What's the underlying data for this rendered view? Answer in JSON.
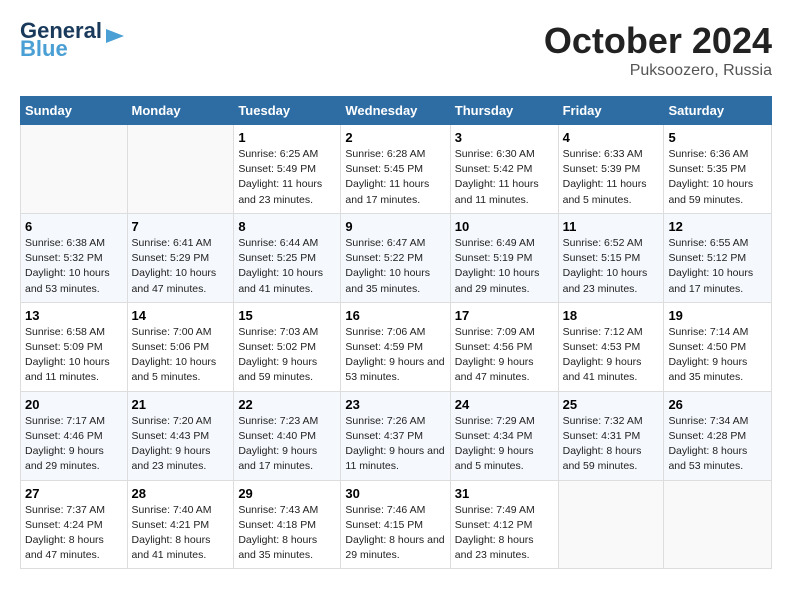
{
  "header": {
    "logo_line1": "General",
    "logo_line2": "Blue",
    "title": "October 2024",
    "subtitle": "Puksoozero, Russia"
  },
  "columns": [
    "Sunday",
    "Monday",
    "Tuesday",
    "Wednesday",
    "Thursday",
    "Friday",
    "Saturday"
  ],
  "weeks": [
    [
      {
        "day": "",
        "info": ""
      },
      {
        "day": "",
        "info": ""
      },
      {
        "day": "1",
        "info": "Sunrise: 6:25 AM\nSunset: 5:49 PM\nDaylight: 11 hours and 23 minutes."
      },
      {
        "day": "2",
        "info": "Sunrise: 6:28 AM\nSunset: 5:45 PM\nDaylight: 11 hours and 17 minutes."
      },
      {
        "day": "3",
        "info": "Sunrise: 6:30 AM\nSunset: 5:42 PM\nDaylight: 11 hours and 11 minutes."
      },
      {
        "day": "4",
        "info": "Sunrise: 6:33 AM\nSunset: 5:39 PM\nDaylight: 11 hours and 5 minutes."
      },
      {
        "day": "5",
        "info": "Sunrise: 6:36 AM\nSunset: 5:35 PM\nDaylight: 10 hours and 59 minutes."
      }
    ],
    [
      {
        "day": "6",
        "info": "Sunrise: 6:38 AM\nSunset: 5:32 PM\nDaylight: 10 hours and 53 minutes."
      },
      {
        "day": "7",
        "info": "Sunrise: 6:41 AM\nSunset: 5:29 PM\nDaylight: 10 hours and 47 minutes."
      },
      {
        "day": "8",
        "info": "Sunrise: 6:44 AM\nSunset: 5:25 PM\nDaylight: 10 hours and 41 minutes."
      },
      {
        "day": "9",
        "info": "Sunrise: 6:47 AM\nSunset: 5:22 PM\nDaylight: 10 hours and 35 minutes."
      },
      {
        "day": "10",
        "info": "Sunrise: 6:49 AM\nSunset: 5:19 PM\nDaylight: 10 hours and 29 minutes."
      },
      {
        "day": "11",
        "info": "Sunrise: 6:52 AM\nSunset: 5:15 PM\nDaylight: 10 hours and 23 minutes."
      },
      {
        "day": "12",
        "info": "Sunrise: 6:55 AM\nSunset: 5:12 PM\nDaylight: 10 hours and 17 minutes."
      }
    ],
    [
      {
        "day": "13",
        "info": "Sunrise: 6:58 AM\nSunset: 5:09 PM\nDaylight: 10 hours and 11 minutes."
      },
      {
        "day": "14",
        "info": "Sunrise: 7:00 AM\nSunset: 5:06 PM\nDaylight: 10 hours and 5 minutes."
      },
      {
        "day": "15",
        "info": "Sunrise: 7:03 AM\nSunset: 5:02 PM\nDaylight: 9 hours and 59 minutes."
      },
      {
        "day": "16",
        "info": "Sunrise: 7:06 AM\nSunset: 4:59 PM\nDaylight: 9 hours and 53 minutes."
      },
      {
        "day": "17",
        "info": "Sunrise: 7:09 AM\nSunset: 4:56 PM\nDaylight: 9 hours and 47 minutes."
      },
      {
        "day": "18",
        "info": "Sunrise: 7:12 AM\nSunset: 4:53 PM\nDaylight: 9 hours and 41 minutes."
      },
      {
        "day": "19",
        "info": "Sunrise: 7:14 AM\nSunset: 4:50 PM\nDaylight: 9 hours and 35 minutes."
      }
    ],
    [
      {
        "day": "20",
        "info": "Sunrise: 7:17 AM\nSunset: 4:46 PM\nDaylight: 9 hours and 29 minutes."
      },
      {
        "day": "21",
        "info": "Sunrise: 7:20 AM\nSunset: 4:43 PM\nDaylight: 9 hours and 23 minutes."
      },
      {
        "day": "22",
        "info": "Sunrise: 7:23 AM\nSunset: 4:40 PM\nDaylight: 9 hours and 17 minutes."
      },
      {
        "day": "23",
        "info": "Sunrise: 7:26 AM\nSunset: 4:37 PM\nDaylight: 9 hours and 11 minutes."
      },
      {
        "day": "24",
        "info": "Sunrise: 7:29 AM\nSunset: 4:34 PM\nDaylight: 9 hours and 5 minutes."
      },
      {
        "day": "25",
        "info": "Sunrise: 7:32 AM\nSunset: 4:31 PM\nDaylight: 8 hours and 59 minutes."
      },
      {
        "day": "26",
        "info": "Sunrise: 7:34 AM\nSunset: 4:28 PM\nDaylight: 8 hours and 53 minutes."
      }
    ],
    [
      {
        "day": "27",
        "info": "Sunrise: 7:37 AM\nSunset: 4:24 PM\nDaylight: 8 hours and 47 minutes."
      },
      {
        "day": "28",
        "info": "Sunrise: 7:40 AM\nSunset: 4:21 PM\nDaylight: 8 hours and 41 minutes."
      },
      {
        "day": "29",
        "info": "Sunrise: 7:43 AM\nSunset: 4:18 PM\nDaylight: 8 hours and 35 minutes."
      },
      {
        "day": "30",
        "info": "Sunrise: 7:46 AM\nSunset: 4:15 PM\nDaylight: 8 hours and 29 minutes."
      },
      {
        "day": "31",
        "info": "Sunrise: 7:49 AM\nSunset: 4:12 PM\nDaylight: 8 hours and 23 minutes."
      },
      {
        "day": "",
        "info": ""
      },
      {
        "day": "",
        "info": ""
      }
    ]
  ]
}
